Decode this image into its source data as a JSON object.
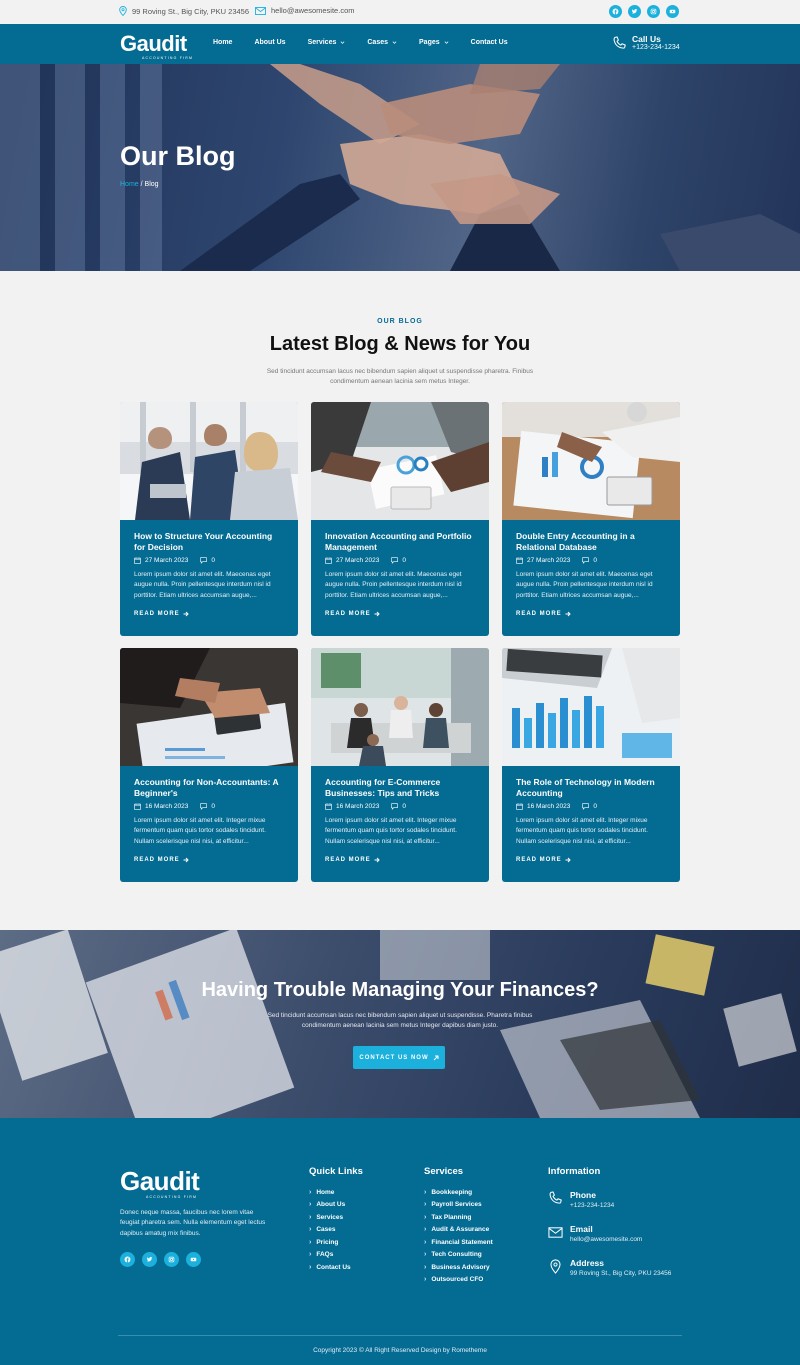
{
  "topbar": {
    "address": "99 Roving St., Big City, PKU 23456",
    "email": "hello@awesomesite.com",
    "socials": [
      "facebook-icon",
      "twitter-icon",
      "instagram-icon",
      "youtube-icon"
    ]
  },
  "brand": {
    "name": "Gaudit",
    "tagline": "ACCOUNTING FIRM",
    "accent": "#1bb1dc",
    "primary": "#046b93"
  },
  "nav": {
    "items": [
      {
        "label": "Home",
        "dropdown": false
      },
      {
        "label": "About Us",
        "dropdown": false
      },
      {
        "label": "Services",
        "dropdown": true
      },
      {
        "label": "Cases",
        "dropdown": true
      },
      {
        "label": "Pages",
        "dropdown": true
      },
      {
        "label": "Contact Us",
        "dropdown": false
      }
    ],
    "call_label": "Call Us",
    "call_number": "+123-234-1234"
  },
  "hero": {
    "title": "Our Blog",
    "crumb_home": "Home",
    "crumb_sep": " / ",
    "crumb_current": "Blog"
  },
  "blog": {
    "tag": "OUR BLOG",
    "title": "Latest Blog & News for You",
    "desc": "Sed tincidunt accumsan lacus nec bibendum sapien aliquet ut suspendisse pharetra. Finibus condimentum aenean lacinia sem metus Integer.",
    "read_more": "READ MORE",
    "posts": [
      {
        "title": "How to Structure Your Accounting for Decision",
        "date": "27 March 2023",
        "comments": "0",
        "excerpt": "Lorem ipsum dolor sit amet elit. Maecenas eget augue nulla. Proin pellentesque interdum nisl id porttitor. Etiam ultrices accumsan augue,..."
      },
      {
        "title": "Innovation Accounting and Portfolio Management",
        "date": "27 March 2023",
        "comments": "0",
        "excerpt": "Lorem ipsum dolor sit amet elit. Maecenas eget augue nulla. Proin pellentesque interdum nisl id porttitor. Etiam ultrices accumsan augue,..."
      },
      {
        "title": "Double Entry Accounting in a Relational Database",
        "date": "27 March 2023",
        "comments": "0",
        "excerpt": "Lorem ipsum dolor sit amet elit. Maecenas eget augue nulla. Proin pellentesque interdum nisl id porttitor. Etiam ultrices accumsan augue,..."
      },
      {
        "title": "Accounting for Non-Accountants: A Beginner's",
        "date": "16 March 2023",
        "comments": "0",
        "excerpt": "Lorem ipsum dolor sit amet elit. Integer mixue fermentum quam quis tortor sodales tincidunt. Nullam scelerisque nisl nisi, at efficitur..."
      },
      {
        "title": "Accounting for E-Commerce Businesses: Tips and Tricks",
        "date": "16 March 2023",
        "comments": "0",
        "excerpt": "Lorem ipsum dolor sit amet elit. Integer mixue fermentum quam quis tortor sodales tincidunt. Nullam scelerisque nisl nisi, at efficitur..."
      },
      {
        "title": "The Role of Technology in Modern Accounting",
        "date": "16 March 2023",
        "comments": "0",
        "excerpt": "Lorem ipsum dolor sit amet elit. Integer mixue fermentum quam quis tortor sodales tincidunt. Nullam scelerisque nisl nisi, at efficitur..."
      }
    ]
  },
  "cta": {
    "title": "Having Trouble Managing Your Finances?",
    "desc": "Sed tincidunt accumsan lacus nec bibendum sapien aliquet ut suspendisse. Pharetra finibus condimentum aenean lacinia sem metus Integer dapibus diam justo.",
    "button": "CONTACT US NOW"
  },
  "footer": {
    "about": "Donec neque massa, faucibus nec lorem vitae feugiat pharetra sem. Nulla elementum eget lectus dapibus amatug mix finibus.",
    "quick_links_title": "Quick Links",
    "quick_links": [
      "Home",
      "About Us",
      "Services",
      "Cases",
      "Pricing",
      "FAQs",
      "Contact Us"
    ],
    "services_title": "Services",
    "services": [
      "Bookkeeping",
      "Payroll Services",
      "Tax Planning",
      "Audit & Assurance",
      "Financial Statement",
      "Tech Consulting",
      "Business Advisory",
      "Outsourced CFO"
    ],
    "info_title": "Information",
    "phone_label": "Phone",
    "phone": "+123-234-1234",
    "email_label": "Email",
    "email": "hello@awesomesite.com",
    "address_label": "Address",
    "address": "99 Roving St., Big City, PKU 23456",
    "copyright": "Copyright 2023 © All Right Reserved Design by Rometheme"
  }
}
